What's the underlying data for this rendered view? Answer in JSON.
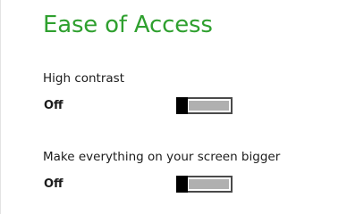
{
  "page": {
    "title": "Ease of Access",
    "accent_color": "#2fa02f"
  },
  "settings": [
    {
      "label": "High contrast",
      "state_text": "Off",
      "on": false
    },
    {
      "label": "Make everything on your screen bigger",
      "state_text": "Off",
      "on": false
    }
  ]
}
